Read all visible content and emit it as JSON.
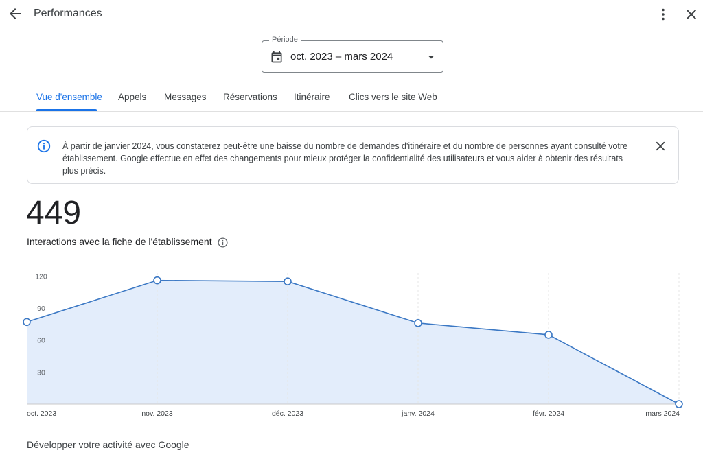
{
  "header": {
    "title": "Performances",
    "back_icon": "arrow-back-icon",
    "more_icon": "more-vert-icon",
    "close_icon": "close-icon"
  },
  "period": {
    "label": "Période",
    "value": "oct. 2023 – mars 2024",
    "icon": "calendar-icon",
    "dropdown_icon": "caret-down-icon"
  },
  "tabs": [
    {
      "label": "Vue d'ensemble",
      "active": true
    },
    {
      "label": "Appels",
      "active": false
    },
    {
      "label": "Messages",
      "active": false
    },
    {
      "label": "Réservations",
      "active": false
    },
    {
      "label": "Itinéraire",
      "active": false
    },
    {
      "label": "Clics vers le site Web",
      "active": false
    }
  ],
  "notice": {
    "text": "À partir de janvier 2024, vous constaterez peut-être une baisse du nombre de demandes d'itinéraire et du nombre de personnes ayant consulté votre établissement. Google effectue en effet des changements pour mieux protéger la confidentialité des utilisateurs et vous aider à obtenir des résultats plus précis.",
    "icon": "info-icon",
    "dismiss_icon": "close-icon"
  },
  "metric": {
    "value": "449",
    "label": "Interactions avec la fiche de l'établissement",
    "info_icon": "info-outline-icon"
  },
  "chart_data": {
    "type": "area",
    "categories": [
      "oct. 2023",
      "nov. 2023",
      "déc. 2023",
      "janv. 2024",
      "févr. 2024",
      "mars 2024"
    ],
    "series": [
      {
        "values": [
          77,
          116,
          115,
          76,
          65,
          0
        ]
      }
    ],
    "yticks": [
      30,
      60,
      90,
      120
    ],
    "ylim": [
      0,
      128
    ],
    "grid": "vertical dashed",
    "colors": {
      "line": "#3b78c4",
      "fill": "#e3edfb"
    }
  },
  "footer": {
    "title": "Développer votre activité avec Google"
  }
}
